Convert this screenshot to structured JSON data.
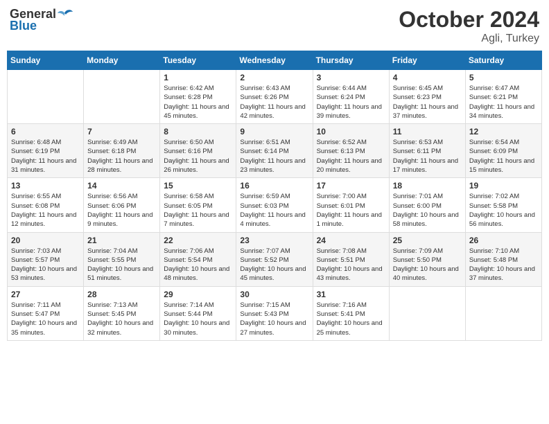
{
  "header": {
    "logo_general": "General",
    "logo_blue": "Blue",
    "month": "October 2024",
    "location": "Agli, Turkey"
  },
  "weekdays": [
    "Sunday",
    "Monday",
    "Tuesday",
    "Wednesday",
    "Thursday",
    "Friday",
    "Saturday"
  ],
  "weeks": [
    [
      {
        "day": "",
        "info": ""
      },
      {
        "day": "",
        "info": ""
      },
      {
        "day": "1",
        "info": "Sunrise: 6:42 AM\nSunset: 6:28 PM\nDaylight: 11 hours and 45 minutes."
      },
      {
        "day": "2",
        "info": "Sunrise: 6:43 AM\nSunset: 6:26 PM\nDaylight: 11 hours and 42 minutes."
      },
      {
        "day": "3",
        "info": "Sunrise: 6:44 AM\nSunset: 6:24 PM\nDaylight: 11 hours and 39 minutes."
      },
      {
        "day": "4",
        "info": "Sunrise: 6:45 AM\nSunset: 6:23 PM\nDaylight: 11 hours and 37 minutes."
      },
      {
        "day": "5",
        "info": "Sunrise: 6:47 AM\nSunset: 6:21 PM\nDaylight: 11 hours and 34 minutes."
      }
    ],
    [
      {
        "day": "6",
        "info": "Sunrise: 6:48 AM\nSunset: 6:19 PM\nDaylight: 11 hours and 31 minutes."
      },
      {
        "day": "7",
        "info": "Sunrise: 6:49 AM\nSunset: 6:18 PM\nDaylight: 11 hours and 28 minutes."
      },
      {
        "day": "8",
        "info": "Sunrise: 6:50 AM\nSunset: 6:16 PM\nDaylight: 11 hours and 26 minutes."
      },
      {
        "day": "9",
        "info": "Sunrise: 6:51 AM\nSunset: 6:14 PM\nDaylight: 11 hours and 23 minutes."
      },
      {
        "day": "10",
        "info": "Sunrise: 6:52 AM\nSunset: 6:13 PM\nDaylight: 11 hours and 20 minutes."
      },
      {
        "day": "11",
        "info": "Sunrise: 6:53 AM\nSunset: 6:11 PM\nDaylight: 11 hours and 17 minutes."
      },
      {
        "day": "12",
        "info": "Sunrise: 6:54 AM\nSunset: 6:09 PM\nDaylight: 11 hours and 15 minutes."
      }
    ],
    [
      {
        "day": "13",
        "info": "Sunrise: 6:55 AM\nSunset: 6:08 PM\nDaylight: 11 hours and 12 minutes."
      },
      {
        "day": "14",
        "info": "Sunrise: 6:56 AM\nSunset: 6:06 PM\nDaylight: 11 hours and 9 minutes."
      },
      {
        "day": "15",
        "info": "Sunrise: 6:58 AM\nSunset: 6:05 PM\nDaylight: 11 hours and 7 minutes."
      },
      {
        "day": "16",
        "info": "Sunrise: 6:59 AM\nSunset: 6:03 PM\nDaylight: 11 hours and 4 minutes."
      },
      {
        "day": "17",
        "info": "Sunrise: 7:00 AM\nSunset: 6:01 PM\nDaylight: 11 hours and 1 minute."
      },
      {
        "day": "18",
        "info": "Sunrise: 7:01 AM\nSunset: 6:00 PM\nDaylight: 10 hours and 58 minutes."
      },
      {
        "day": "19",
        "info": "Sunrise: 7:02 AM\nSunset: 5:58 PM\nDaylight: 10 hours and 56 minutes."
      }
    ],
    [
      {
        "day": "20",
        "info": "Sunrise: 7:03 AM\nSunset: 5:57 PM\nDaylight: 10 hours and 53 minutes."
      },
      {
        "day": "21",
        "info": "Sunrise: 7:04 AM\nSunset: 5:55 PM\nDaylight: 10 hours and 51 minutes."
      },
      {
        "day": "22",
        "info": "Sunrise: 7:06 AM\nSunset: 5:54 PM\nDaylight: 10 hours and 48 minutes."
      },
      {
        "day": "23",
        "info": "Sunrise: 7:07 AM\nSunset: 5:52 PM\nDaylight: 10 hours and 45 minutes."
      },
      {
        "day": "24",
        "info": "Sunrise: 7:08 AM\nSunset: 5:51 PM\nDaylight: 10 hours and 43 minutes."
      },
      {
        "day": "25",
        "info": "Sunrise: 7:09 AM\nSunset: 5:50 PM\nDaylight: 10 hours and 40 minutes."
      },
      {
        "day": "26",
        "info": "Sunrise: 7:10 AM\nSunset: 5:48 PM\nDaylight: 10 hours and 37 minutes."
      }
    ],
    [
      {
        "day": "27",
        "info": "Sunrise: 7:11 AM\nSunset: 5:47 PM\nDaylight: 10 hours and 35 minutes."
      },
      {
        "day": "28",
        "info": "Sunrise: 7:13 AM\nSunset: 5:45 PM\nDaylight: 10 hours and 32 minutes."
      },
      {
        "day": "29",
        "info": "Sunrise: 7:14 AM\nSunset: 5:44 PM\nDaylight: 10 hours and 30 minutes."
      },
      {
        "day": "30",
        "info": "Sunrise: 7:15 AM\nSunset: 5:43 PM\nDaylight: 10 hours and 27 minutes."
      },
      {
        "day": "31",
        "info": "Sunrise: 7:16 AM\nSunset: 5:41 PM\nDaylight: 10 hours and 25 minutes."
      },
      {
        "day": "",
        "info": ""
      },
      {
        "day": "",
        "info": ""
      }
    ]
  ]
}
